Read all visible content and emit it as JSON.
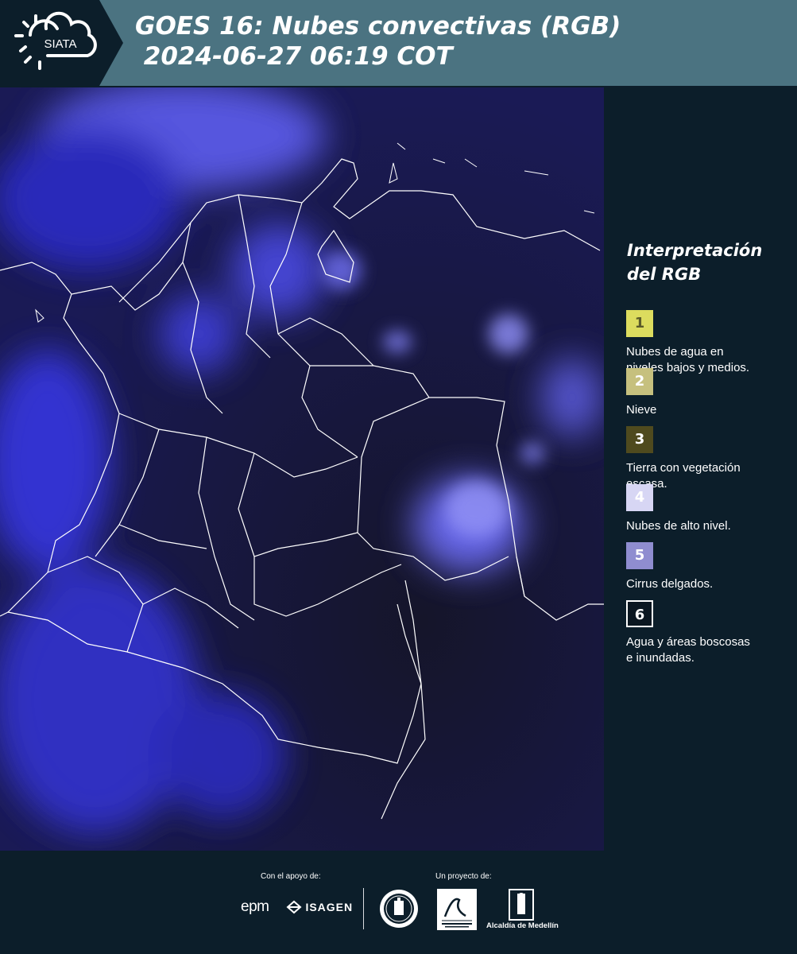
{
  "header": {
    "logo_text": "SIATA",
    "title_line1": "GOES 16: Nubes convectivas (RGB)",
    "title_line2": " 2024-06-27 06:19 COT"
  },
  "legend": {
    "title_line1": "Interpretación",
    "title_line2": "del RGB",
    "items": [
      {
        "number": "1",
        "color": "#dcdc5e",
        "num_color": "#5a5a2a",
        "text_line1": "Nubes de agua en",
        "text_line2": "niveles bajos y medios."
      },
      {
        "number": "2",
        "color": "#c6c07e",
        "num_color": "#ffffff",
        "text_line1": "Nieve",
        "text_line2": ""
      },
      {
        "number": "3",
        "color": "#4f4a1e",
        "num_color": "#ffffff",
        "text_line1": "Tierra con vegetación",
        "text_line2": "escasa."
      },
      {
        "number": "4",
        "color": "#d7d6f4",
        "num_color": "#ffffff",
        "text_line1": "Nubes de alto nivel.",
        "text_line2": ""
      },
      {
        "number": "5",
        "color": "#8f8dd0",
        "num_color": "#ffffff",
        "text_line1": "Cirrus delgados.",
        "text_line2": ""
      },
      {
        "number": "6",
        "color": "#0b1721",
        "num_color": "#ffffff",
        "text_line1": "Agua y áreas boscosas",
        "text_line2": "e inundadas."
      }
    ]
  },
  "footer": {
    "support_label": "Con el apoyo de:",
    "project_label": "Un proyecto de:",
    "sponsors": [
      "epm",
      "ISAGEN"
    ],
    "partners": [
      "Área Metropolitana Valle de Aburrá",
      "Alcaldía de Medellín"
    ],
    "alcaldia_text": "Alcaldía de Medellín"
  },
  "colors": {
    "header_bg": "#4b7381",
    "page_bg": "#0c1e2a",
    "map_bg": "#15154a",
    "cloud": "#4747ff"
  }
}
